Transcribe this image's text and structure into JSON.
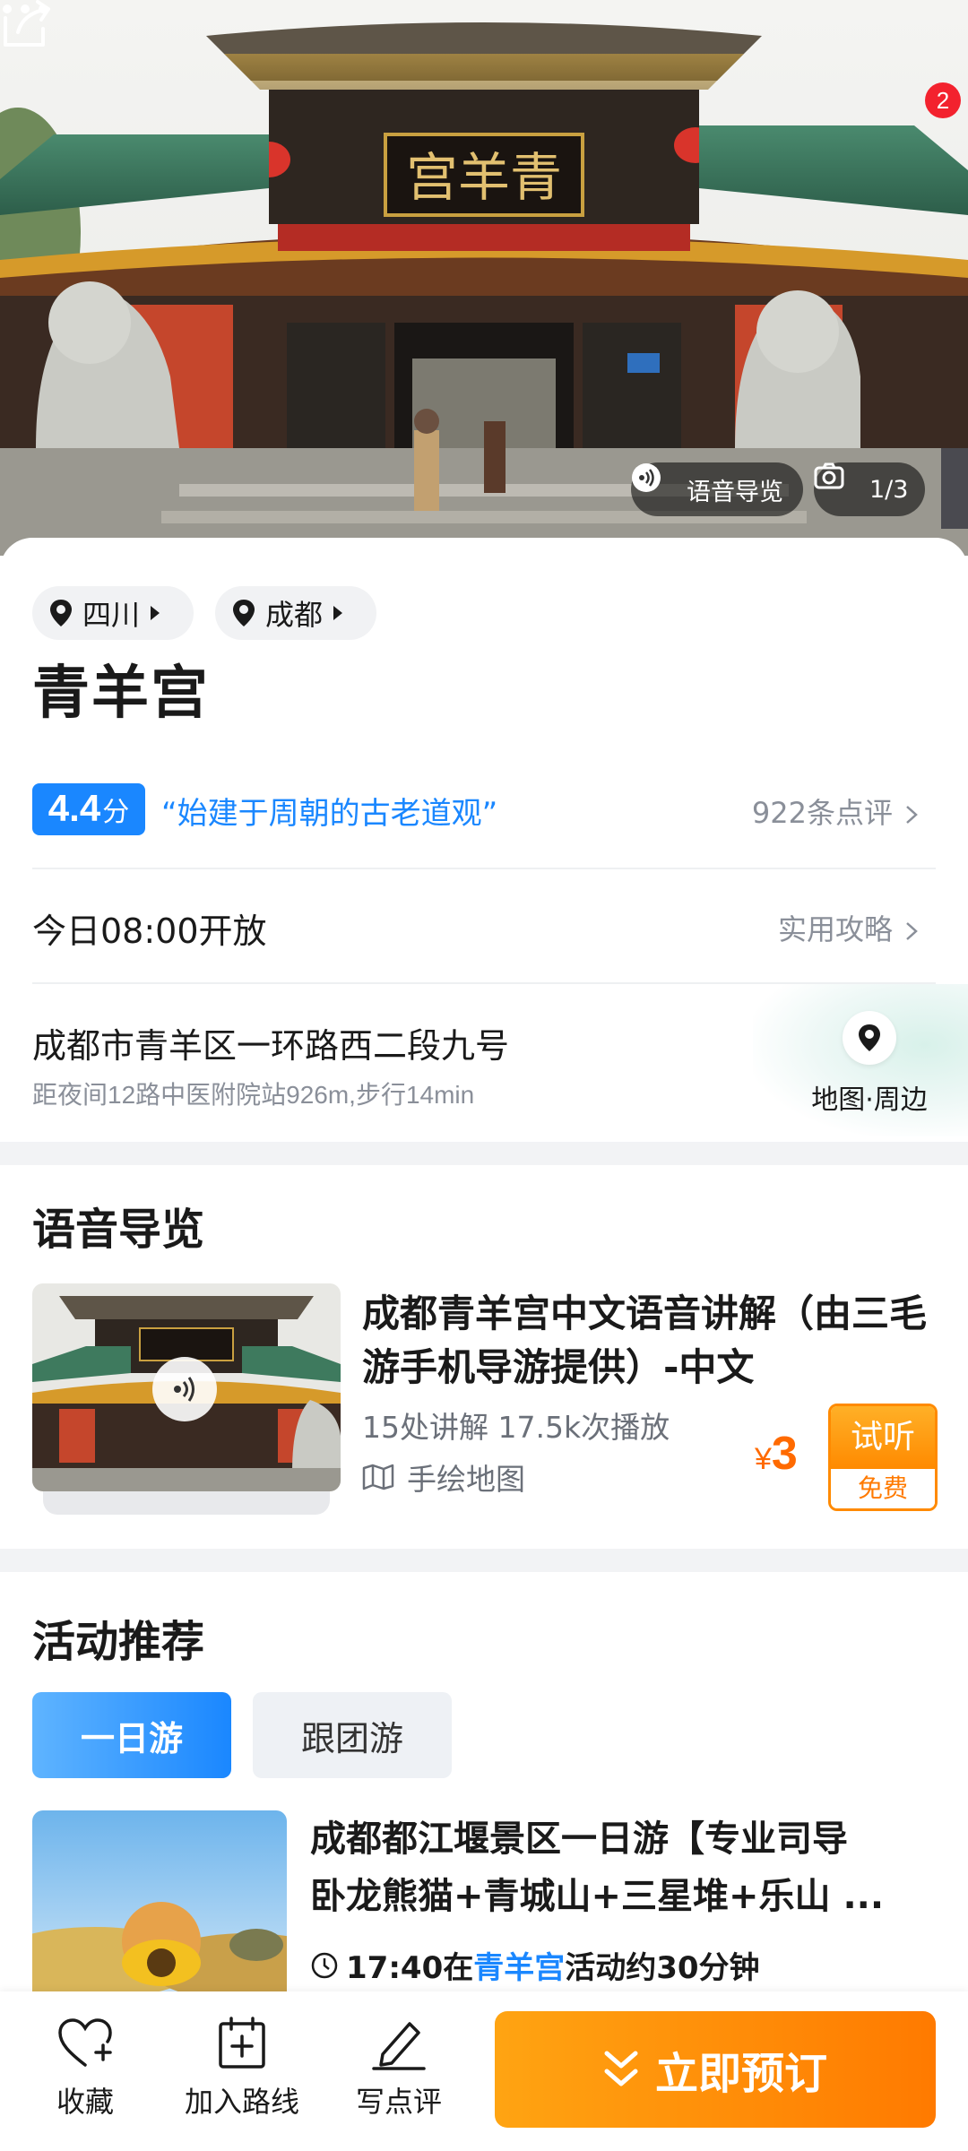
{
  "hero": {
    "notification_count": "2",
    "audio_guide_label": "语音导览",
    "photo_counter": "1/3",
    "plaque_text": "宫羊青"
  },
  "location": {
    "province": "四川",
    "city": "成都"
  },
  "poi": {
    "name": "青羊宫",
    "rating": "4.4",
    "rating_unit": "分",
    "quote": "“始建于周朝的古老道观”",
    "review_count": "922条点评",
    "open_status": "今日08:00开放",
    "guide_link": "实用攻略",
    "address": "成都市青羊区一环路西二段九号",
    "distance": "距夜间12路中医附院站926m,步行14min",
    "map_label": "地图·周边"
  },
  "audio_section": {
    "title": "语音导览",
    "item_title": "成都青羊宫中文语音讲解（由三毛游手机导游提供）-中文",
    "stats": "15处讲解  17.5k次播放",
    "map_text": "手绘地图",
    "currency": "¥",
    "price": "3",
    "try_label": "试听",
    "free_label": "免费"
  },
  "activities": {
    "title": "活动推荐",
    "tabs": [
      {
        "label": "一日游",
        "active": true
      },
      {
        "label": "跟团游",
        "active": false
      }
    ],
    "item": {
      "title_line1": "成都都江堰景区一日游【专业司导",
      "title_line2": "卧龙熊猫+青城山+三星堆+乐山 ...",
      "time": "17:40在",
      "place": "青羊宫",
      "duration": "活动约30分钟"
    }
  },
  "bottom_bar": {
    "favorite": "收藏",
    "add_route": "加入路线",
    "write_review": "写点评",
    "book_now": "立即预订"
  },
  "colors": {
    "accent_blue": "#1a87ff",
    "accent_orange": "#ff7a00",
    "badge_red": "#f3222e"
  },
  "icons": [
    "share-icon",
    "more-icon",
    "audio-icon",
    "camera-icon",
    "location-pin-icon",
    "chevron-right-icon",
    "map-icon",
    "heart-plus-icon",
    "calendar-plus-icon",
    "pen-icon",
    "double-chevron-down-icon",
    "clock-icon"
  ]
}
